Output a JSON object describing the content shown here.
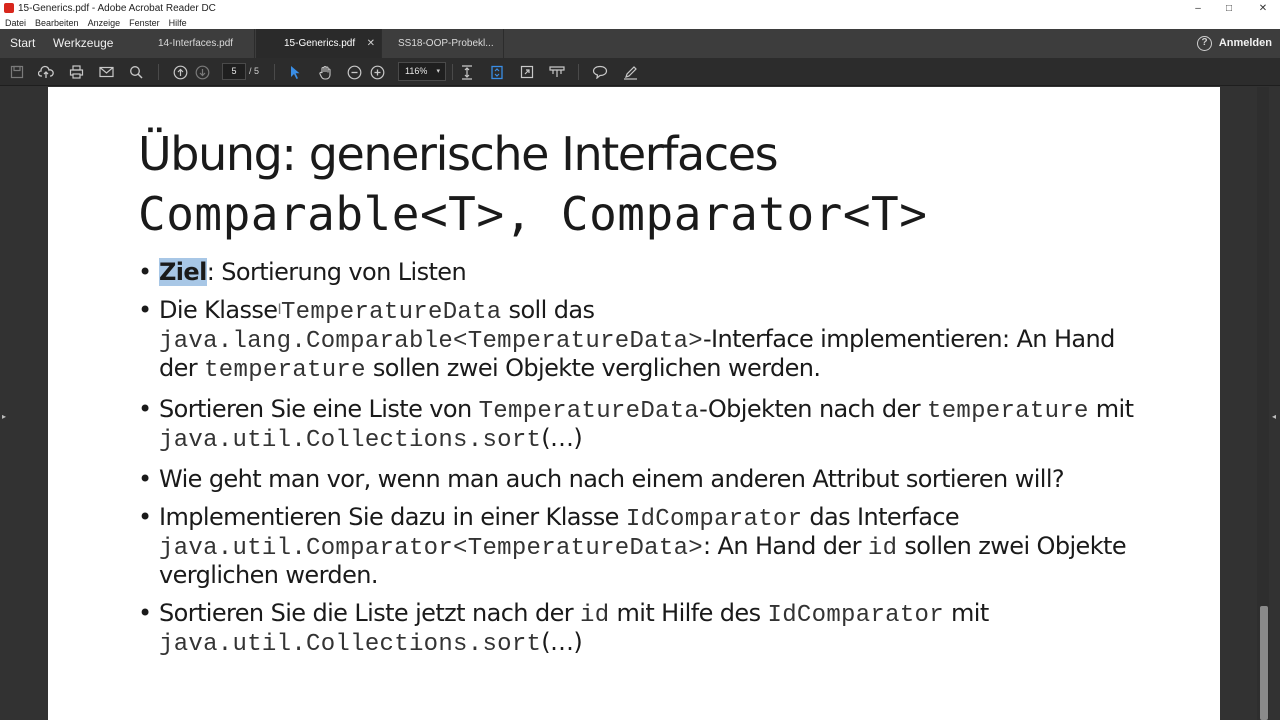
{
  "window": {
    "title": "15-Generics.pdf - Adobe Acrobat Reader DC",
    "controls": [
      "–",
      "□",
      "✕"
    ]
  },
  "menu": [
    "Datei",
    "Bearbeiten",
    "Anzeige",
    "Fenster",
    "Hilfe"
  ],
  "nav": {
    "start": "Start",
    "tools": "Werkzeuge",
    "signin": "Anmelden",
    "help": "?"
  },
  "tabs": [
    {
      "label": "14-Interfaces.pdf",
      "active": false
    },
    {
      "label": "15-Generics.pdf",
      "active": true,
      "close": "✕"
    },
    {
      "label": "SS18-OOP-Probekl...",
      "active": false
    }
  ],
  "toolbar": {
    "page_current": "5",
    "page_total": "/ 5",
    "zoom": "116%",
    "zoom_caret": "▾"
  },
  "side_arrows": {
    "left": "▸",
    "right": "◂"
  },
  "slide": {
    "title_line1": "Übung: generische Interfaces",
    "title_line2": "Comparable<T>, Comparator<T>",
    "b1": {
      "highlight": "Ziel",
      "rest": ": Sortierung von Listen"
    },
    "b2": {
      "t1": "Die Klasse",
      "cursor": "I",
      "c1": "TemperatureData",
      "t2": " soll das ",
      "c2": "java.lang.Comparable<TemperatureData>",
      "t3": "-Interface implementieren: An Hand der ",
      "c3": "temperature",
      "t4": " sollen zwei Objekte verglichen werden."
    },
    "b3": {
      "t1": "Sortieren Sie eine Liste von ",
      "c1": "TemperatureData",
      "t2": "-Objekten nach der ",
      "c2": "temperature",
      "t3": " mit ",
      "c3": "java.util.Collections.sort",
      "t4": "(…)"
    },
    "b4": {
      "text": "Wie geht man vor, wenn man auch nach einem anderen Attribut sortieren will?"
    },
    "b5": {
      "t1": "Implementieren Sie dazu in einer Klasse ",
      "c1": "IdComparator",
      "t2": " das Interface ",
      "c2": "java.util.Comparator<TemperatureData>",
      "t3": ": An Hand der ",
      "c3": "id",
      "t4": " sollen zwei Objekte verglichen werden."
    },
    "b6": {
      "t1": "Sortieren Sie die Liste jetzt nach der ",
      "c1": "id",
      "t2": " mit Hilfe des ",
      "c2": "IdComparator",
      "t3": "  mit ",
      "c3": "java.util.Collections.sort",
      "t4": "(…)"
    },
    "bullet_char": "•"
  }
}
